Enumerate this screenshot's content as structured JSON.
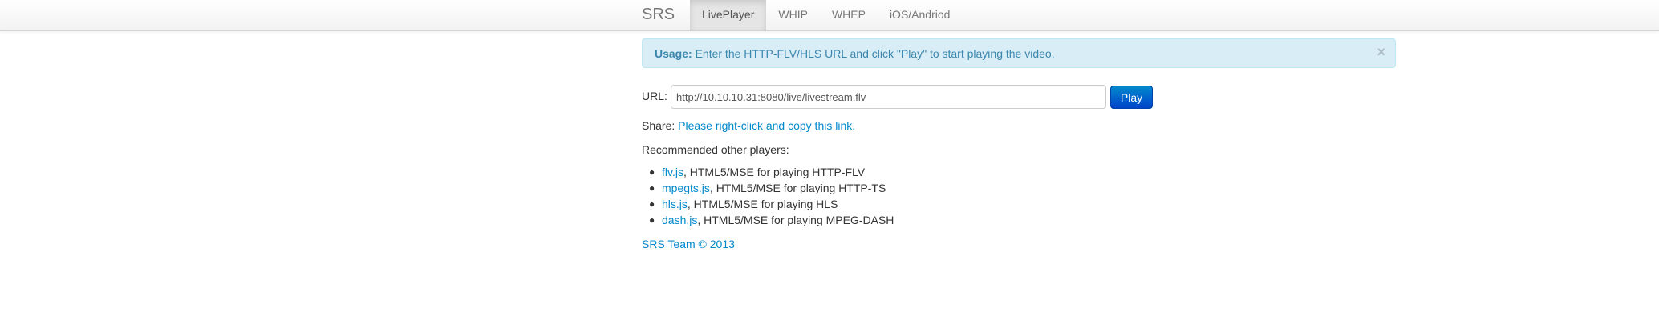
{
  "navbar": {
    "brand": "SRS",
    "items": [
      {
        "label": "LivePlayer",
        "active": true
      },
      {
        "label": "WHIP",
        "active": false
      },
      {
        "label": "WHEP",
        "active": false
      },
      {
        "label": "iOS/Andriod",
        "active": false
      }
    ]
  },
  "alert": {
    "title": "Usage:",
    "message": "Enter the HTTP-FLV/HLS URL and click \"Play\" to start playing the video.",
    "close_glyph": "×"
  },
  "player": {
    "url_label": "URL:",
    "url_value": "http://10.10.10.31:8080/live/livestream.flv",
    "play_label": "Play"
  },
  "share": {
    "label": "Share:",
    "link_text": "Please right-click and copy this link."
  },
  "recommend": {
    "heading": "Recommended other players:",
    "players": [
      {
        "name": "flv.js",
        "desc": ", HTML5/MSE for playing HTTP-FLV"
      },
      {
        "name": "mpegts.js",
        "desc": ", HTML5/MSE for playing HTTP-TS"
      },
      {
        "name": "hls.js",
        "desc": ", HTML5/MSE for playing HLS"
      },
      {
        "name": "dash.js",
        "desc": ", HTML5/MSE for playing MPEG-DASH"
      }
    ]
  },
  "footer": {
    "text": "SRS Team © 2013"
  },
  "colors": {
    "link": "#0088cc",
    "alert_bg": "#d9edf7",
    "alert_text": "#3a87ad",
    "primary_button": "#0055cc"
  }
}
